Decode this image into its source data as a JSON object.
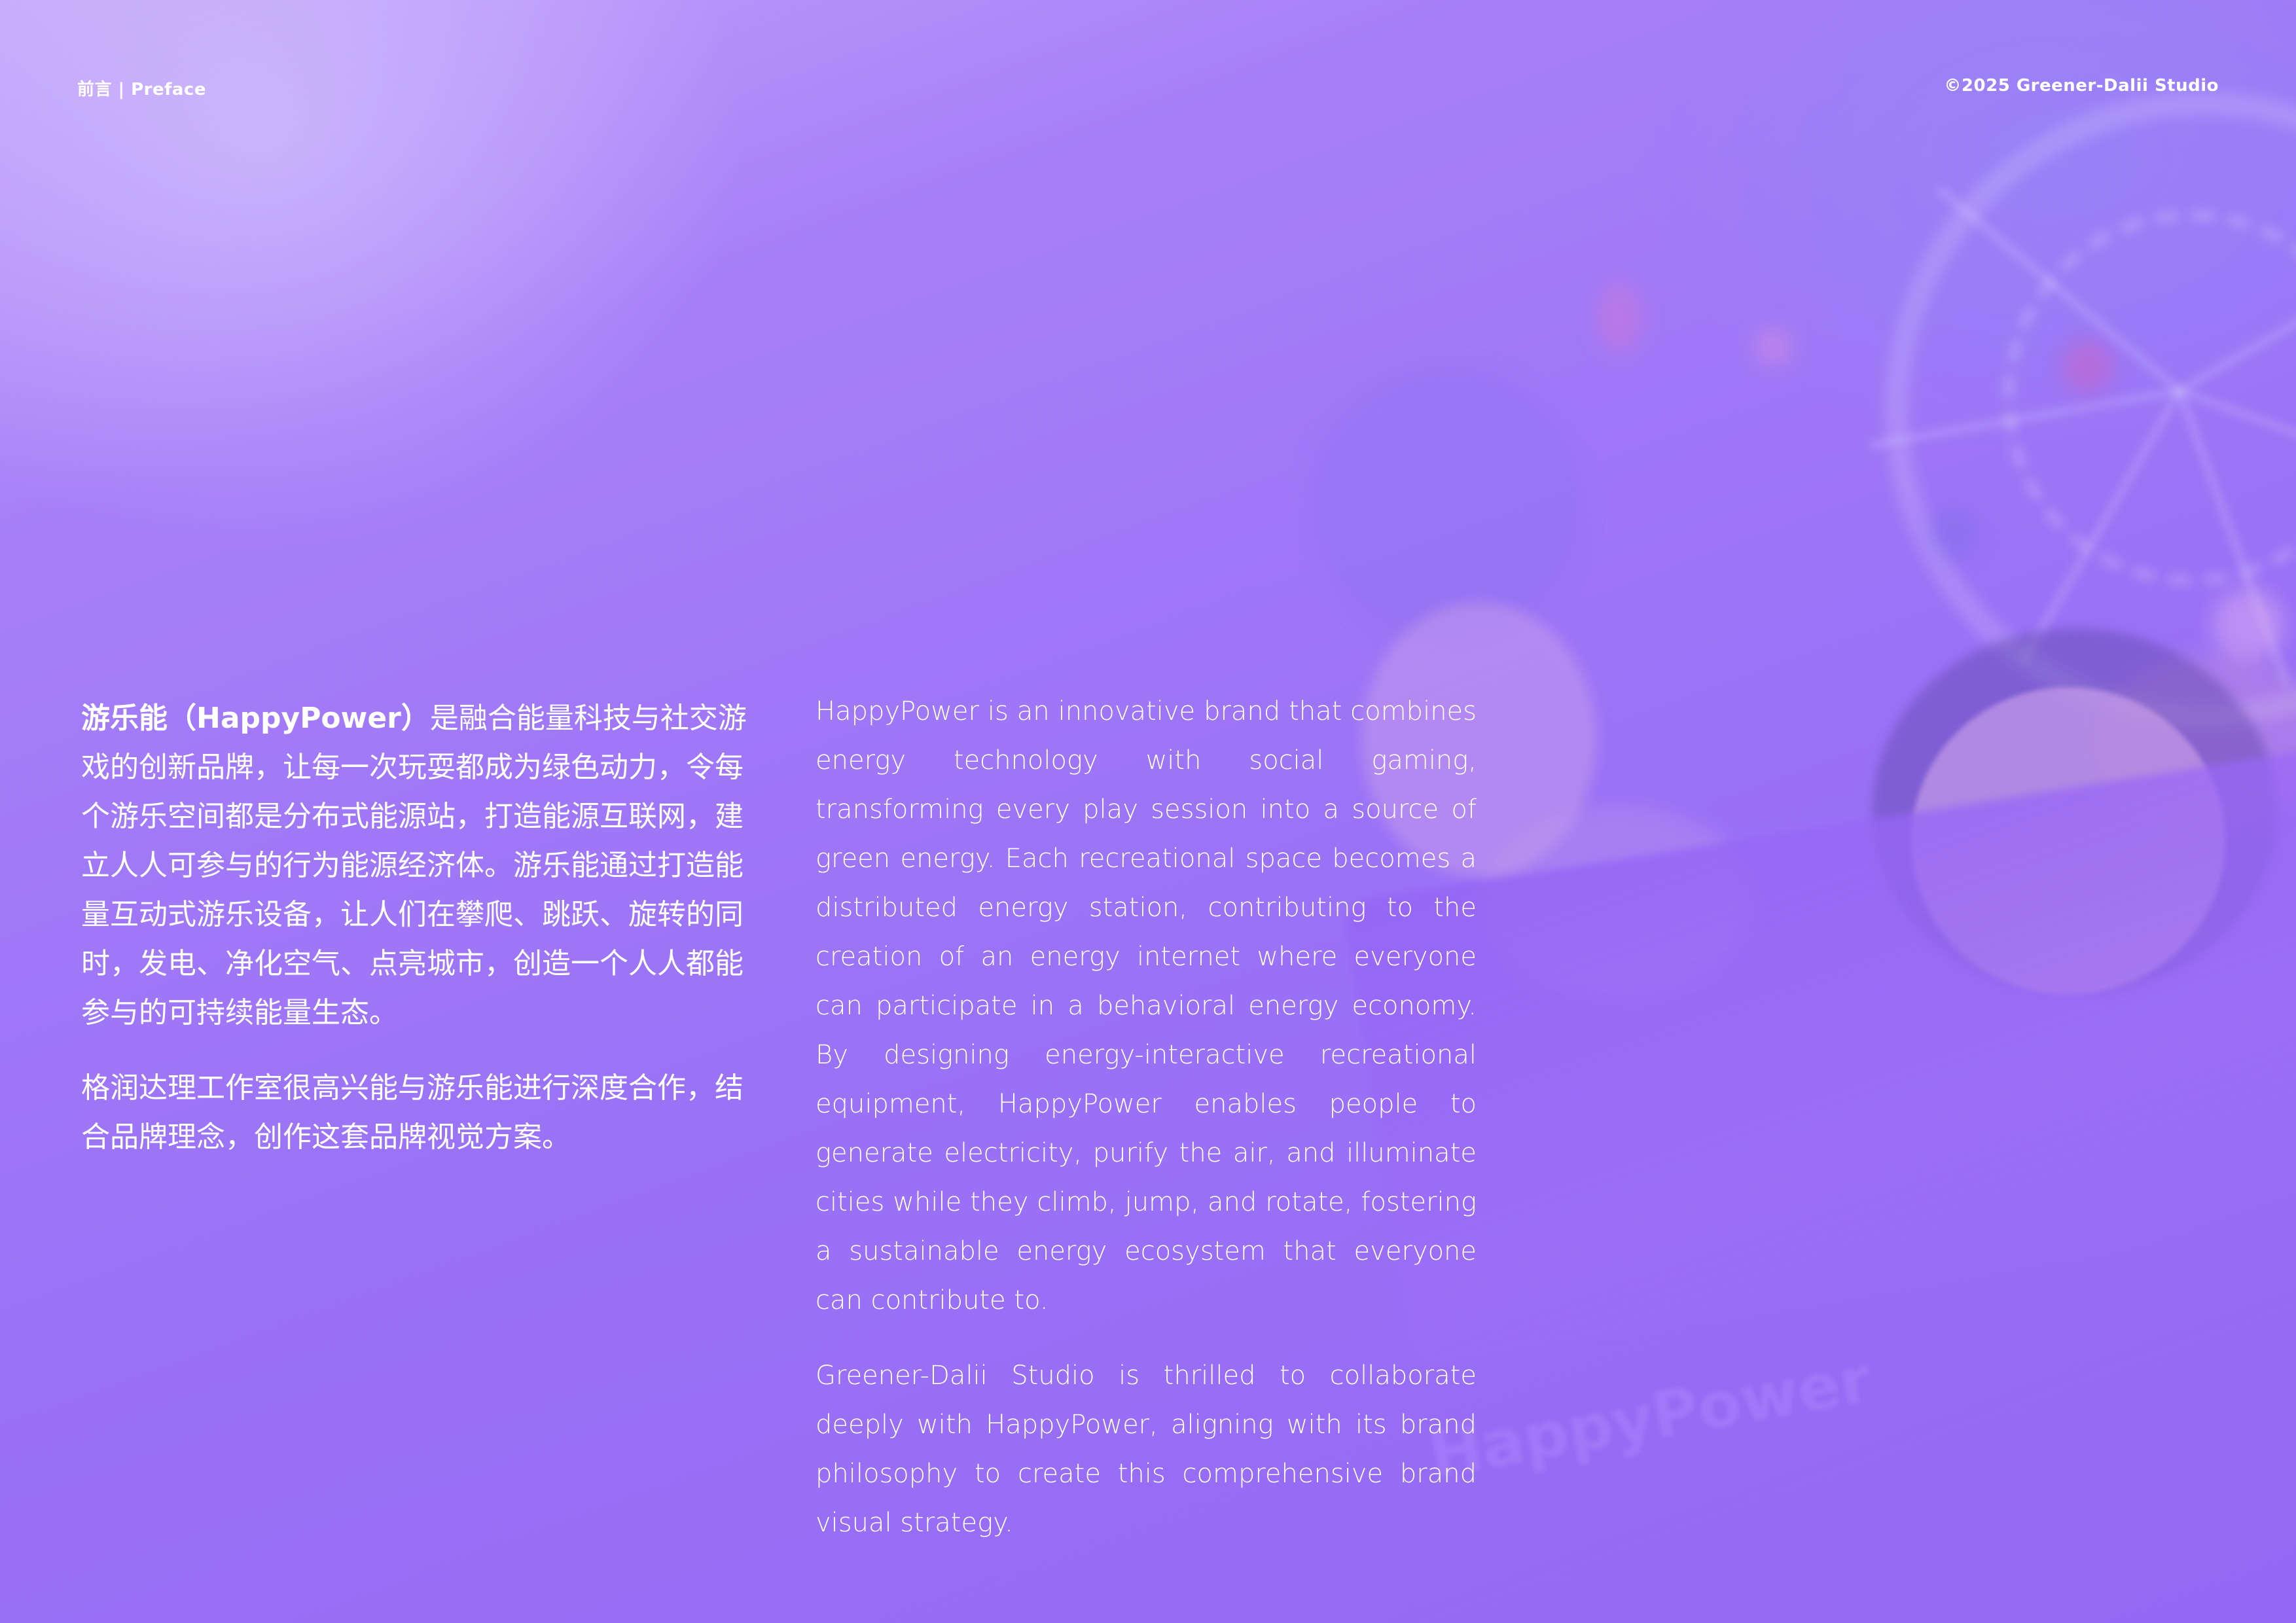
{
  "header": {
    "left": "前言 | Preface",
    "right": "©2025 Greener-Dalii Studio"
  },
  "chinese": {
    "brand_strong": "游乐能（HappyPower）",
    "para1_rest": "是融合能量科技与社交游戏的创新品牌，让每一次玩耍都成为绿色动力，令每个游乐空间都是分布式能源站，打造能源互联网，建立人人可参与的行为能源经济体。游乐能通过打造能量互动式游乐设备，让人们在攀爬、跳跃、旋转的同时，发电、净化空气、点亮城市，创造一个人人都能参与的可持续能量生态。",
    "para2": "格润达理工作室很高兴能与游乐能进行深度合作，结合品牌理念，创作这套品牌视觉方案。"
  },
  "english": {
    "para1": "HappyPower is an innovative brand that combines energy technology with social gaming, transforming every play session into a source of green energy. Each recreational space becomes a distributed energy station, contributing to the creation of an energy internet where everyone can participate in a behavioral energy economy. By designing energy-interactive recreational equipment, HappyPower enables people to generate electricity, purify the air, and illuminate cities while they climb, jump, and rotate, fostering a sustainable energy ecosystem that everyone can contribute to.",
    "para2": "Greener-Dalii Studio is thrilled to collaborate deeply with HappyPower, aligning with its brand philosophy to create this comprehensive brand visual strategy."
  },
  "watermark": "HappyPower"
}
